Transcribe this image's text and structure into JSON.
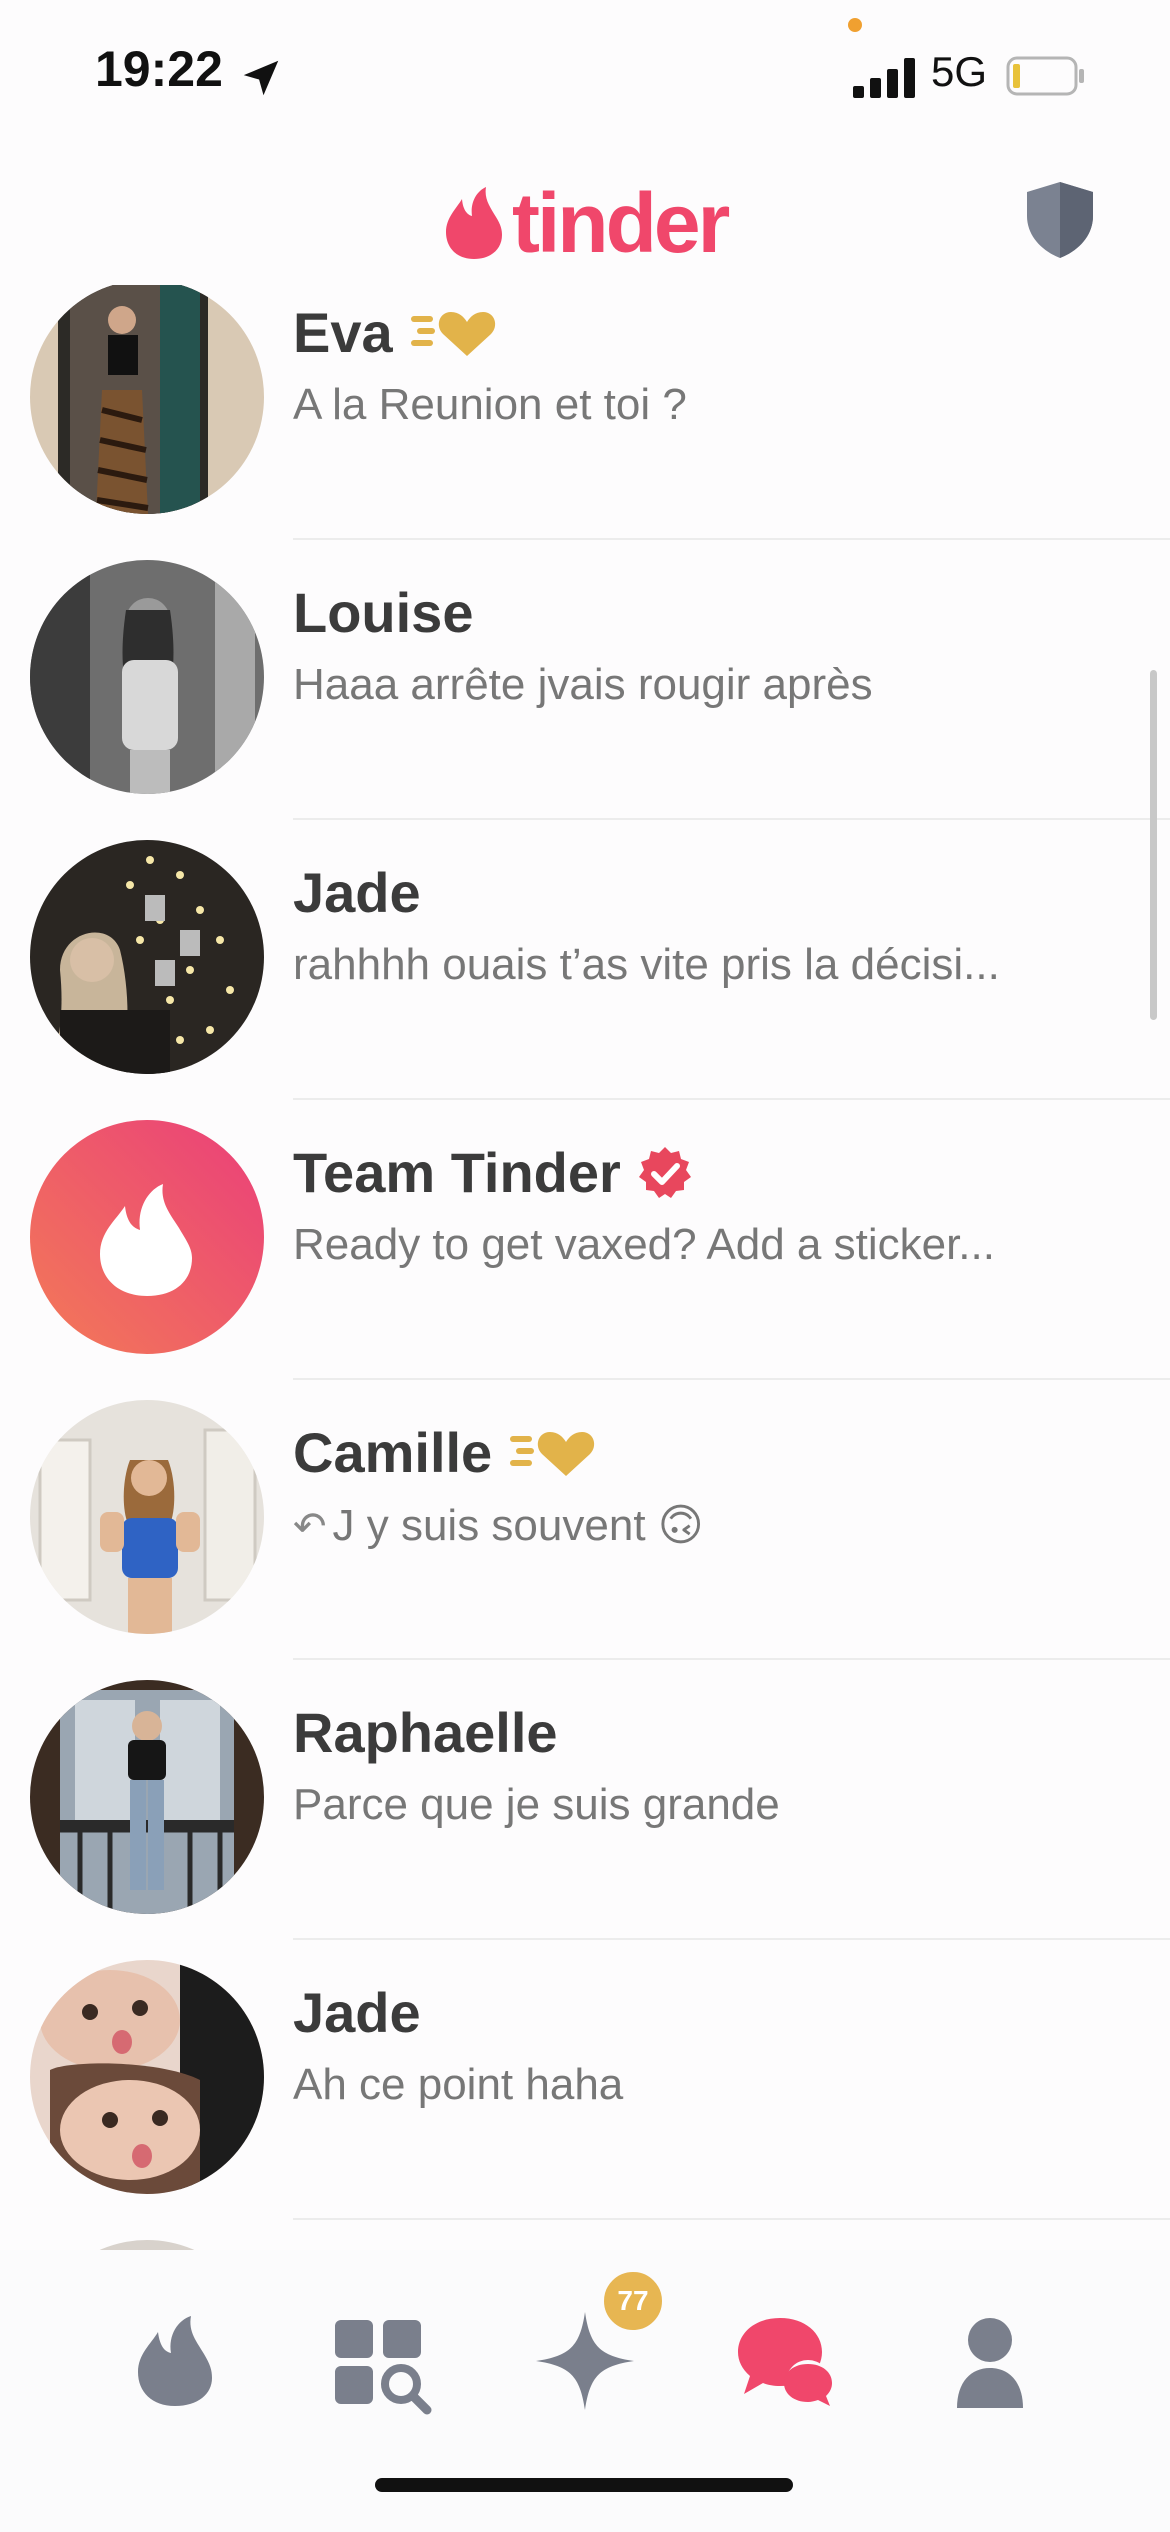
{
  "status_bar": {
    "time": "19:22",
    "network": "5G"
  },
  "header": {
    "logo_text": "tinder"
  },
  "conversations": [
    {
      "name": "Eva",
      "message": "A la Reunion et toi ?",
      "badge": "super-like-icon"
    },
    {
      "name": "Louise",
      "message": "Haaa arrête jvais rougir après"
    },
    {
      "name": "Jade",
      "message": "rahhhh ouais t’as vite pris la décisi..."
    },
    {
      "name": "Team Tinder",
      "message": "Ready to get vaxed? Add a sticker...",
      "badge": "verified-icon"
    },
    {
      "name": "Camille",
      "message": "J y suis souvent 🙃",
      "badge": "super-like-icon",
      "reply_indicator": "↶"
    },
    {
      "name": "Raphaelle",
      "message": "Parce que je suis grande"
    },
    {
      "name": "Jade",
      "message": "Ah ce point haha"
    }
  ],
  "bottom_nav": {
    "items": [
      "flame-icon",
      "explore-icon",
      "sparkle-icon",
      "chat-icon",
      "profile-icon"
    ],
    "sparkle_badge": "77"
  },
  "colors": {
    "brand": "#f0476b",
    "gold": "#e2b34a",
    "nav_inactive": "#7a7f8c"
  }
}
